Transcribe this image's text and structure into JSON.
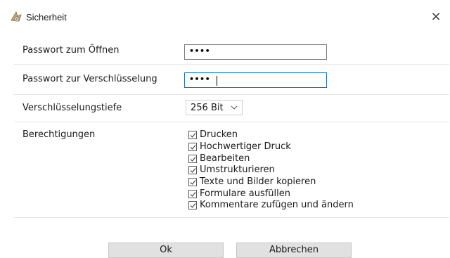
{
  "window": {
    "title": "Sicherheit",
    "close_symbol": "×"
  },
  "form": {
    "open_password": {
      "label": "Passwort zum Öffnen",
      "value": "••••"
    },
    "encrypt_password": {
      "label": "Passwort zur Verschlüsselung",
      "value": "••••"
    },
    "encryption_depth": {
      "label": "Verschlüsselungstiefe",
      "value": "256 Bit"
    },
    "permissions": {
      "label": "Berechtigungen",
      "items": [
        {
          "label": "Drucken",
          "checked": true
        },
        {
          "label": "Hochwertiger Druck",
          "checked": true
        },
        {
          "label": "Bearbeiten",
          "checked": true
        },
        {
          "label": "Umstrukturieren",
          "checked": true
        },
        {
          "label": "Texte und Bilder kopieren",
          "checked": true
        },
        {
          "label": "Formulare ausfüllen",
          "checked": true
        },
        {
          "label": "Kommentare zufügen und ändern",
          "checked": true
        }
      ]
    }
  },
  "buttons": {
    "ok": "Ok",
    "cancel": "Abbrechen"
  },
  "icons": {
    "app": "security-app-icon",
    "close": "close-icon",
    "check": "checkmark-icon",
    "chevron": "chevron-down-icon"
  }
}
